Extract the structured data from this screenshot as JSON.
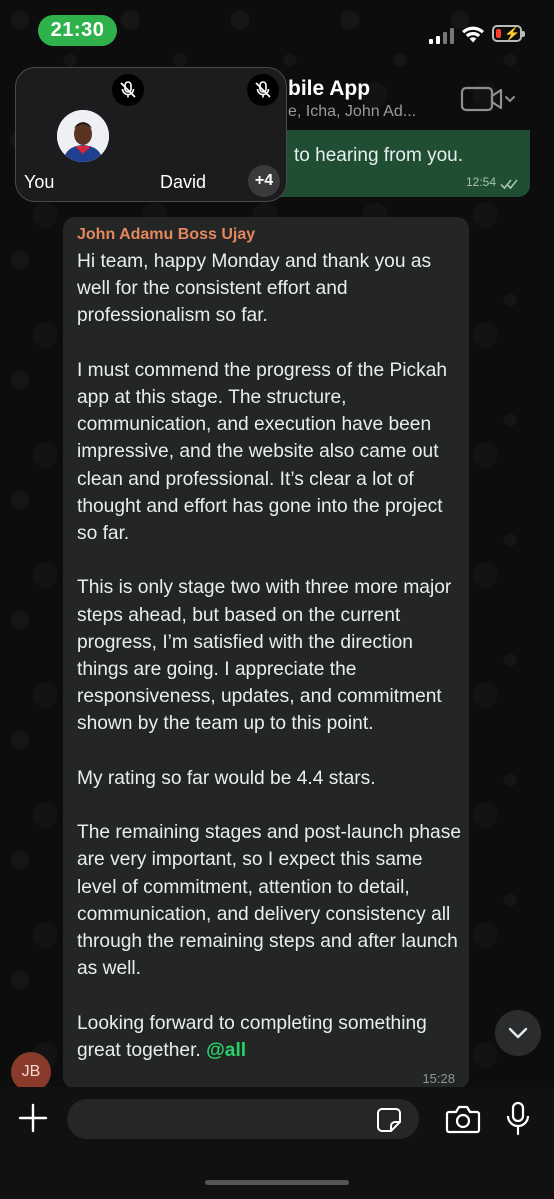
{
  "status_bar": {
    "time": "21:30"
  },
  "header": {
    "title": "bile App",
    "subtitle": "e, Icha, John Ad..."
  },
  "outgoing_message": {
    "text": "to hearing from you.",
    "time": "12:54"
  },
  "call": {
    "participants": [
      {
        "name": "You",
        "muted": true
      },
      {
        "name": "David",
        "muted": true
      }
    ],
    "extra_count": "+4"
  },
  "incoming_message": {
    "sender": "John Adamu Boss Ujay",
    "paragraphs": [
      "Hi team, happy Monday and thank you as well for the consistent effort and professionalism so far.",
      "I must commend the progress of the Pickah app at this stage. The structure, communication, and execution have been impressive, and the website also came out clean and professional. It’s clear a lot of thought and effort has gone into the project so far.",
      "This is only stage two with three more major steps ahead, but based on the current progress, I’m satisfied with the direction things are going. I appreciate the responsiveness, updates, and commitment shown by the team up to this point.",
      "My rating so far would be 4.4 stars.",
      "The remaining stages and post-launch phase are very important, so I expect this same level of commitment, attention to detail, communication, and delivery consistency all through the remaining steps and after launch as well."
    ],
    "last_paragraph": "Looking forward to completing something great together.",
    "mention": "@all",
    "time": "15:28"
  },
  "sender_avatar": {
    "initials": "JB"
  },
  "composer": {
    "placeholder": "",
    "value": ""
  },
  "colors": {
    "accent": "#25d366",
    "outgoing_bubble": "#1f4e33",
    "incoming_bubble": "#242626",
    "sender_name": "#e4875f",
    "time_pill": "#2fb24c"
  },
  "icons": [
    "mic-off-icon",
    "video-call-icon",
    "chevron-down-icon",
    "double-check-icon",
    "plus-icon",
    "sticker-icon",
    "camera-icon",
    "mic-icon"
  ]
}
